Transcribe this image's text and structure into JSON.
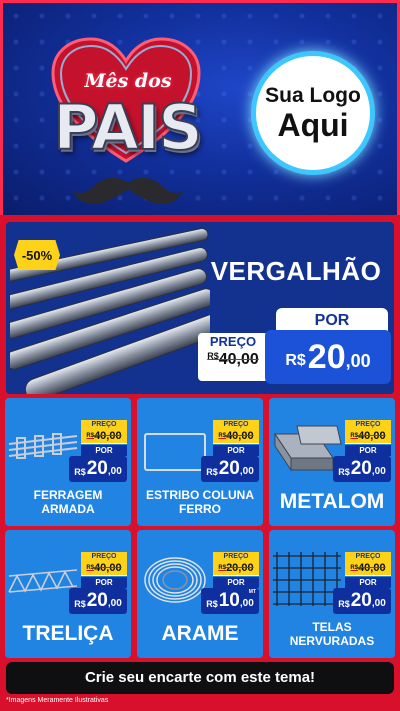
{
  "header": {
    "title_script": "Mês dos",
    "title_main": "PAIS",
    "logo_line1": "Sua Logo",
    "logo_line2": "Aqui"
  },
  "hero": {
    "discount_badge": "-50%",
    "product": "VERGALHÃO",
    "por_label": "POR",
    "preco_label": "PREÇO",
    "old_currency": "R$",
    "old_price": "40,00",
    "currency": "R$",
    "price_int": "20",
    "price_dec": ",00"
  },
  "cards": [
    {
      "name": "FERRAGEM ARMADA",
      "preco_label": "PREÇO",
      "old_currency": "R$",
      "old_price": "40,00",
      "por_label": "POR",
      "currency": "R$",
      "price_int": "20",
      "price_dec": ",00"
    },
    {
      "name": "ESTRIBO COLUNA FERRO",
      "preco_label": "PREÇO",
      "old_currency": "R$",
      "old_price": "40,00",
      "por_label": "POR",
      "currency": "R$",
      "price_int": "20",
      "price_dec": ",00"
    },
    {
      "name": "METALOM",
      "preco_label": "PREÇO",
      "old_currency": "R$",
      "old_price": "40,00",
      "por_label": "POR",
      "currency": "R$",
      "price_int": "20",
      "price_dec": ",00"
    },
    {
      "name": "TRELIÇA",
      "preco_label": "PREÇO",
      "old_currency": "R$",
      "old_price": "40,00",
      "por_label": "POR",
      "currency": "R$",
      "price_int": "20",
      "price_dec": ",00"
    },
    {
      "name": "ARAME",
      "preco_label": "PREÇO",
      "old_currency": "R$",
      "old_price": "20,00",
      "por_label": "POR",
      "currency": "R$",
      "price_int": "10",
      "price_dec": ",00",
      "unit": "MT"
    },
    {
      "name": "TELAS NERVURADAS",
      "preco_label": "PREÇO",
      "old_currency": "R$",
      "old_price": "40,00",
      "por_label": "POR",
      "currency": "R$",
      "price_int": "20",
      "price_dec": ",00"
    }
  ],
  "cta": "Crie seu encarte com este tema!",
  "footnote": "*Imagens Meramente Ilustrativas",
  "colors": {
    "frame_red": "#d8102c",
    "header_blue": "#12309c",
    "card_blue": "#2284e2",
    "price_blue": "#0f2f9e",
    "badge_yellow": "#ffd21a"
  }
}
